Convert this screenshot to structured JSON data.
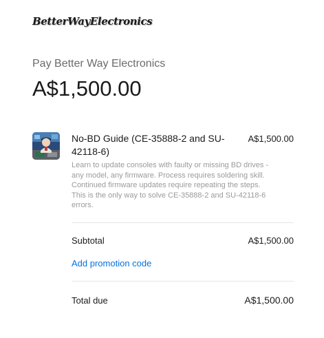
{
  "brand": {
    "logo_text": "BetterWayElectronics"
  },
  "header": {
    "merchant_line": "Pay Better Way Electronics",
    "total_amount": "A$1,500.00"
  },
  "line_item": {
    "name": "No-BD Guide (CE-35888-2 and SU-42118-6)",
    "price": "A$1,500.00",
    "description": "Learn to update consoles with faulty or missing BD drives - any model, any firmware. Process requires soldering skill. Continued firmware updates require repeating the steps. This is the only way to solve CE-35888-2 and SU-42118-6 errors.",
    "thumbnail_icon": "product-thumbnail-image"
  },
  "summary": {
    "subtotal_label": "Subtotal",
    "subtotal_value": "A$1,500.00",
    "promo_label": "Add promotion code",
    "total_label": "Total due",
    "total_value": "A$1,500.00"
  },
  "colors": {
    "link": "#0570de",
    "muted_text": "#9a9a9a",
    "divider": "#e6e6e6"
  }
}
